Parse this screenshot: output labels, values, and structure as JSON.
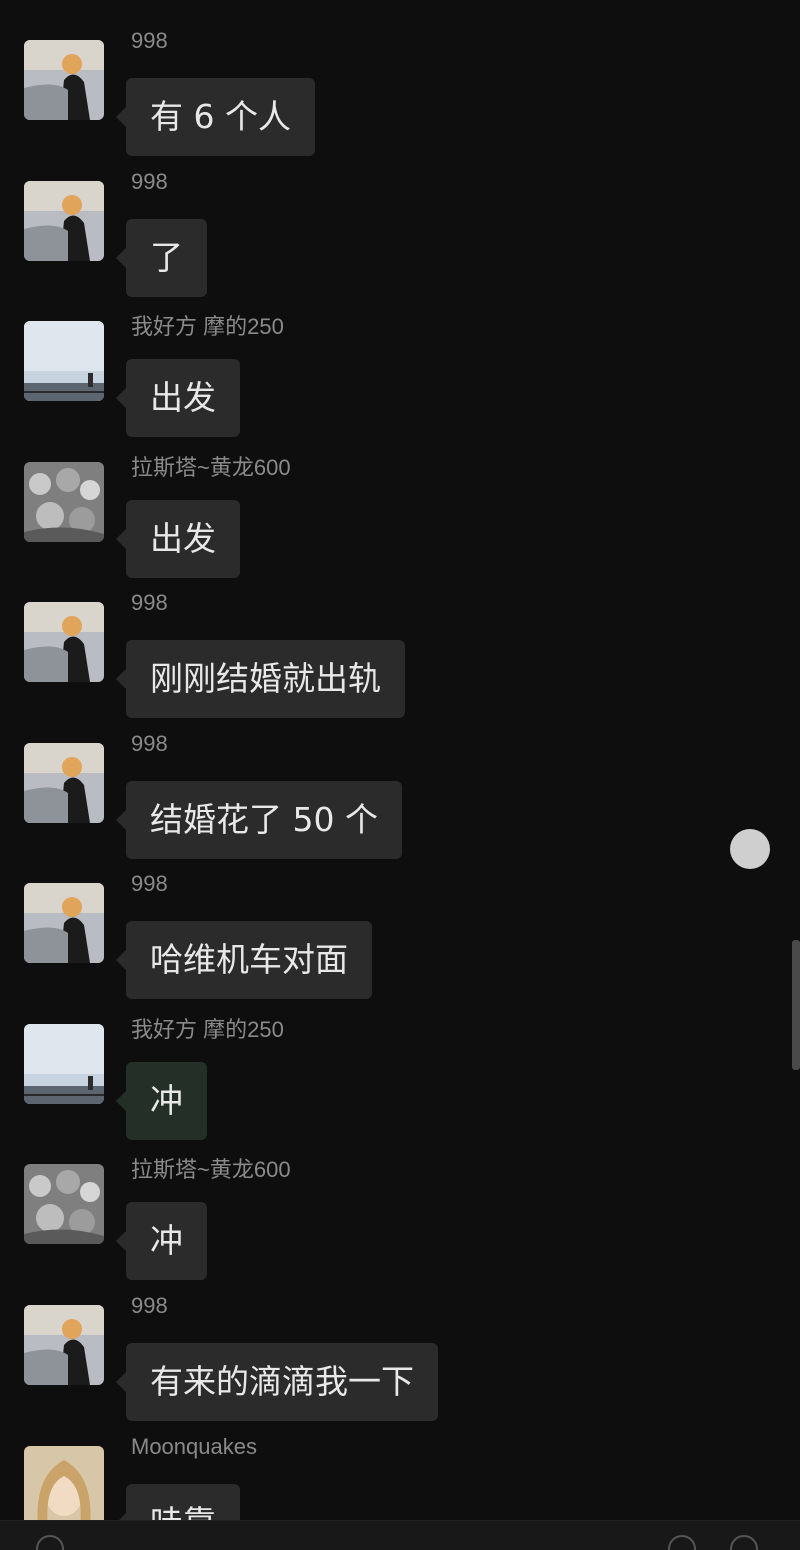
{
  "senders": {
    "s998": "998",
    "wohaofang": "我好方 摩的250",
    "lasita": "拉斯塔~黄龙600",
    "moon": "Moonquakes"
  },
  "messages": [
    {
      "sender": "998",
      "text": "有 6 个人"
    },
    {
      "sender": "998",
      "text": "了"
    },
    {
      "sender": "我好方 摩的250",
      "text": "出发"
    },
    {
      "sender": "拉斯塔~黄龙600",
      "text": "出发"
    },
    {
      "sender": "998",
      "text": "刚刚结婚就出轨"
    },
    {
      "sender": "998",
      "text": "结婚花了 50 个"
    },
    {
      "sender": "998",
      "text": "哈维机车对面"
    },
    {
      "sender": "我好方 摩的250",
      "text": "冲"
    },
    {
      "sender": "拉斯塔~黄龙600",
      "text": "冲"
    },
    {
      "sender": "998",
      "text": "有来的滴滴我一下"
    },
    {
      "sender": "Moonquakes",
      "text": "哇靠"
    }
  ],
  "colors": {
    "background": "#0e0e0e",
    "bubble": "#2b2b2b",
    "bubble_green": "#243027",
    "text": "#e8e8e8",
    "sender": "#8a8a8a"
  },
  "icons": {
    "avatar_998": "sunset-silhouette-avatar",
    "avatar_wohaofang": "seascape-avatar",
    "avatar_lasita": "group-photo-avatar",
    "avatar_moon": "portrait-avatar",
    "floating": "floating-assist-button"
  }
}
